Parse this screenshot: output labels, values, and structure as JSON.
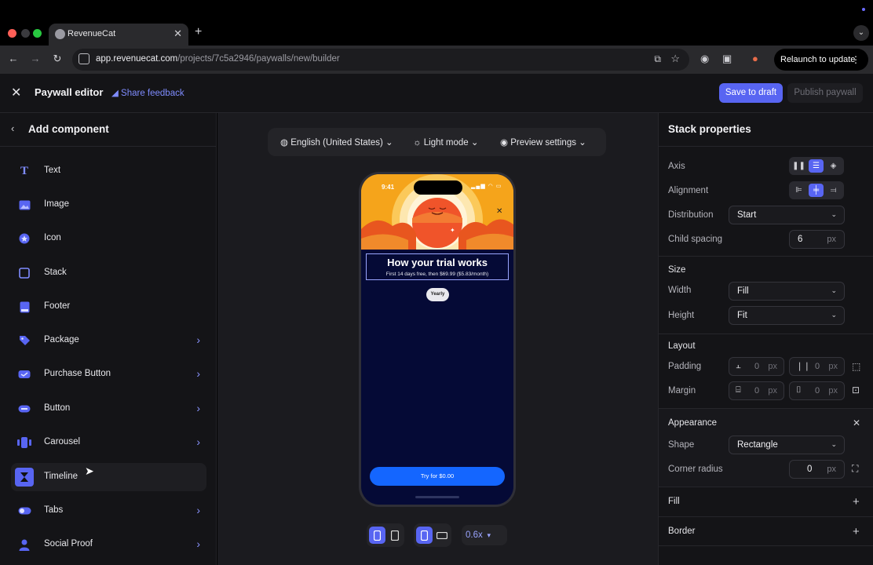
{
  "browser": {
    "tab_title": "RevenueCat",
    "url_domain": "app.revenuecat.com",
    "url_path": "/projects/7c5a2946/paywalls/new/builder",
    "relaunch_label": "Relaunch to update"
  },
  "header": {
    "title": "Paywall editor",
    "feedback_label": "Share feedback",
    "save_label": "Save to draft",
    "publish_label": "Publish paywall"
  },
  "left_panel": {
    "title": "Add component",
    "items": [
      {
        "label": "Text",
        "icon": "text-icon"
      },
      {
        "label": "Image",
        "icon": "image-icon"
      },
      {
        "label": "Icon",
        "icon": "icon-icon"
      },
      {
        "label": "Stack",
        "icon": "stack-icon"
      },
      {
        "label": "Footer",
        "icon": "footer-icon"
      },
      {
        "label": "Package",
        "icon": "tag-icon"
      },
      {
        "label": "Purchase Button",
        "icon": "purchase-button-icon"
      },
      {
        "label": "Button",
        "icon": "button-icon"
      },
      {
        "label": "Carousel",
        "icon": "carousel-icon"
      },
      {
        "label": "Timeline",
        "icon": "hourglass-icon"
      },
      {
        "label": "Tabs",
        "icon": "toggle-icon"
      },
      {
        "label": "Social Proof",
        "icon": "person-icon"
      }
    ]
  },
  "canvas_toolbar": {
    "language": "English (United States)",
    "mode": "Light mode",
    "preview": "Preview settings"
  },
  "preview": {
    "status_time": "9:41",
    "trial_title": "How your trial works",
    "trial_subtitle": "First 14 days free, then $69.99 ($5.83/month)",
    "yearly_badge": "Yearly",
    "cta_label": "Try for $0.00",
    "accent": "#1466ff"
  },
  "zoom": "0.6x",
  "right_panel": {
    "title": "Stack properties",
    "axis_label": "Axis",
    "alignment_label": "Alignment",
    "distribution_label": "Distribution",
    "distribution_value": "Start",
    "child_spacing_label": "Child spacing",
    "child_spacing_value": "6",
    "unit": "px",
    "size_title": "Size",
    "width_label": "Width",
    "width_value": "Fill",
    "height_label": "Height",
    "height_value": "Fit",
    "layout_title": "Layout",
    "padding_label": "Padding",
    "padding_v": "0",
    "padding_h": "0",
    "margin_label": "Margin",
    "margin_v": "0",
    "margin_h": "0",
    "appearance_title": "Appearance",
    "shape_label": "Shape",
    "shape_value": "Rectangle",
    "corner_radius_label": "Corner radius",
    "corner_radius_value": "0",
    "fill_title": "Fill",
    "border_title": "Border"
  },
  "colors": {
    "brand": "#5865f2",
    "panel_bg": "#141417",
    "canvas_bg": "#1b1b1f"
  }
}
